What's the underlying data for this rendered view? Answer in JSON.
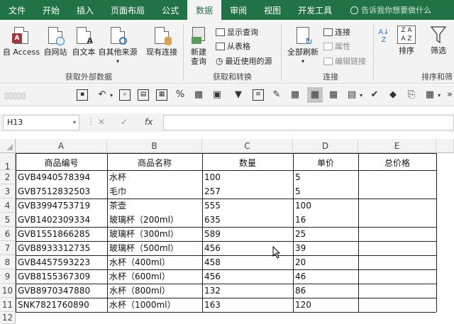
{
  "menu": {
    "tabs": [
      "文件",
      "开始",
      "插入",
      "页面布局",
      "公式",
      "数据",
      "审阅",
      "视图",
      "开发工具"
    ],
    "active_tab": "数据",
    "search_text": "告诉我你想要做什么"
  },
  "ribbon": {
    "get_external": {
      "buttons": [
        "自 Access",
        "自网站",
        "自文本",
        "自其他来源",
        "现有连接"
      ],
      "label": "获取外部数据"
    },
    "get_transform": {
      "new_query": "新建\n查询",
      "show_query": "显示查询",
      "from_table": "从表格",
      "recent_sources": "最近使用的源",
      "label": "获取和转换"
    },
    "connections": {
      "refresh_all": "全部刷新",
      "connections": "连接",
      "properties": "属性",
      "edit_links": "编辑链接",
      "label": "连接"
    },
    "sort_filter": {
      "sort": "排序",
      "filter": "筛选",
      "label": "排序和筛"
    }
  },
  "formula_bar": {
    "name_box": "H13",
    "fx": "fx",
    "formula": ""
  },
  "sheet": {
    "columns": [
      "A",
      "B",
      "C",
      "D",
      "E"
    ],
    "row_numbers": [
      "1",
      "2",
      "3",
      "4",
      "5",
      "6",
      "7",
      "8",
      "9",
      "10",
      "11",
      "12"
    ],
    "headers": [
      "商品编号",
      "商品名称",
      "数量",
      "单价",
      "总价格"
    ],
    "rows": [
      [
        "GVB4940578394",
        "水杯",
        "100",
        "5",
        ""
      ],
      [
        "GVB7512832503",
        "毛巾",
        "257",
        "5",
        ""
      ],
      [
        "GVB3994753719",
        "茶壶",
        "555",
        "100",
        ""
      ],
      [
        "GVB1402309334",
        "玻璃杯（200ml）",
        "635",
        "16",
        ""
      ],
      [
        "GVB1551866285",
        "玻璃杯（300ml）",
        "589",
        "25",
        ""
      ],
      [
        "GVB8933312735",
        "玻璃杯（500ml）",
        "456",
        "39",
        ""
      ],
      [
        "GVB4457593223",
        "水杯（400ml）",
        "458",
        "20",
        ""
      ],
      [
        "GVB8155367309",
        "水杯（600ml）",
        "456",
        "46",
        ""
      ],
      [
        "GVB8970347880",
        "水杯（800ml）",
        "132",
        "86",
        ""
      ],
      [
        "SNK7821760890",
        "水杯（1000ml）",
        "163",
        "120",
        ""
      ]
    ]
  },
  "colors": {
    "excel_green": "#217346",
    "ribbon_bg": "#f3f3f3",
    "grid_line": "#222222"
  }
}
